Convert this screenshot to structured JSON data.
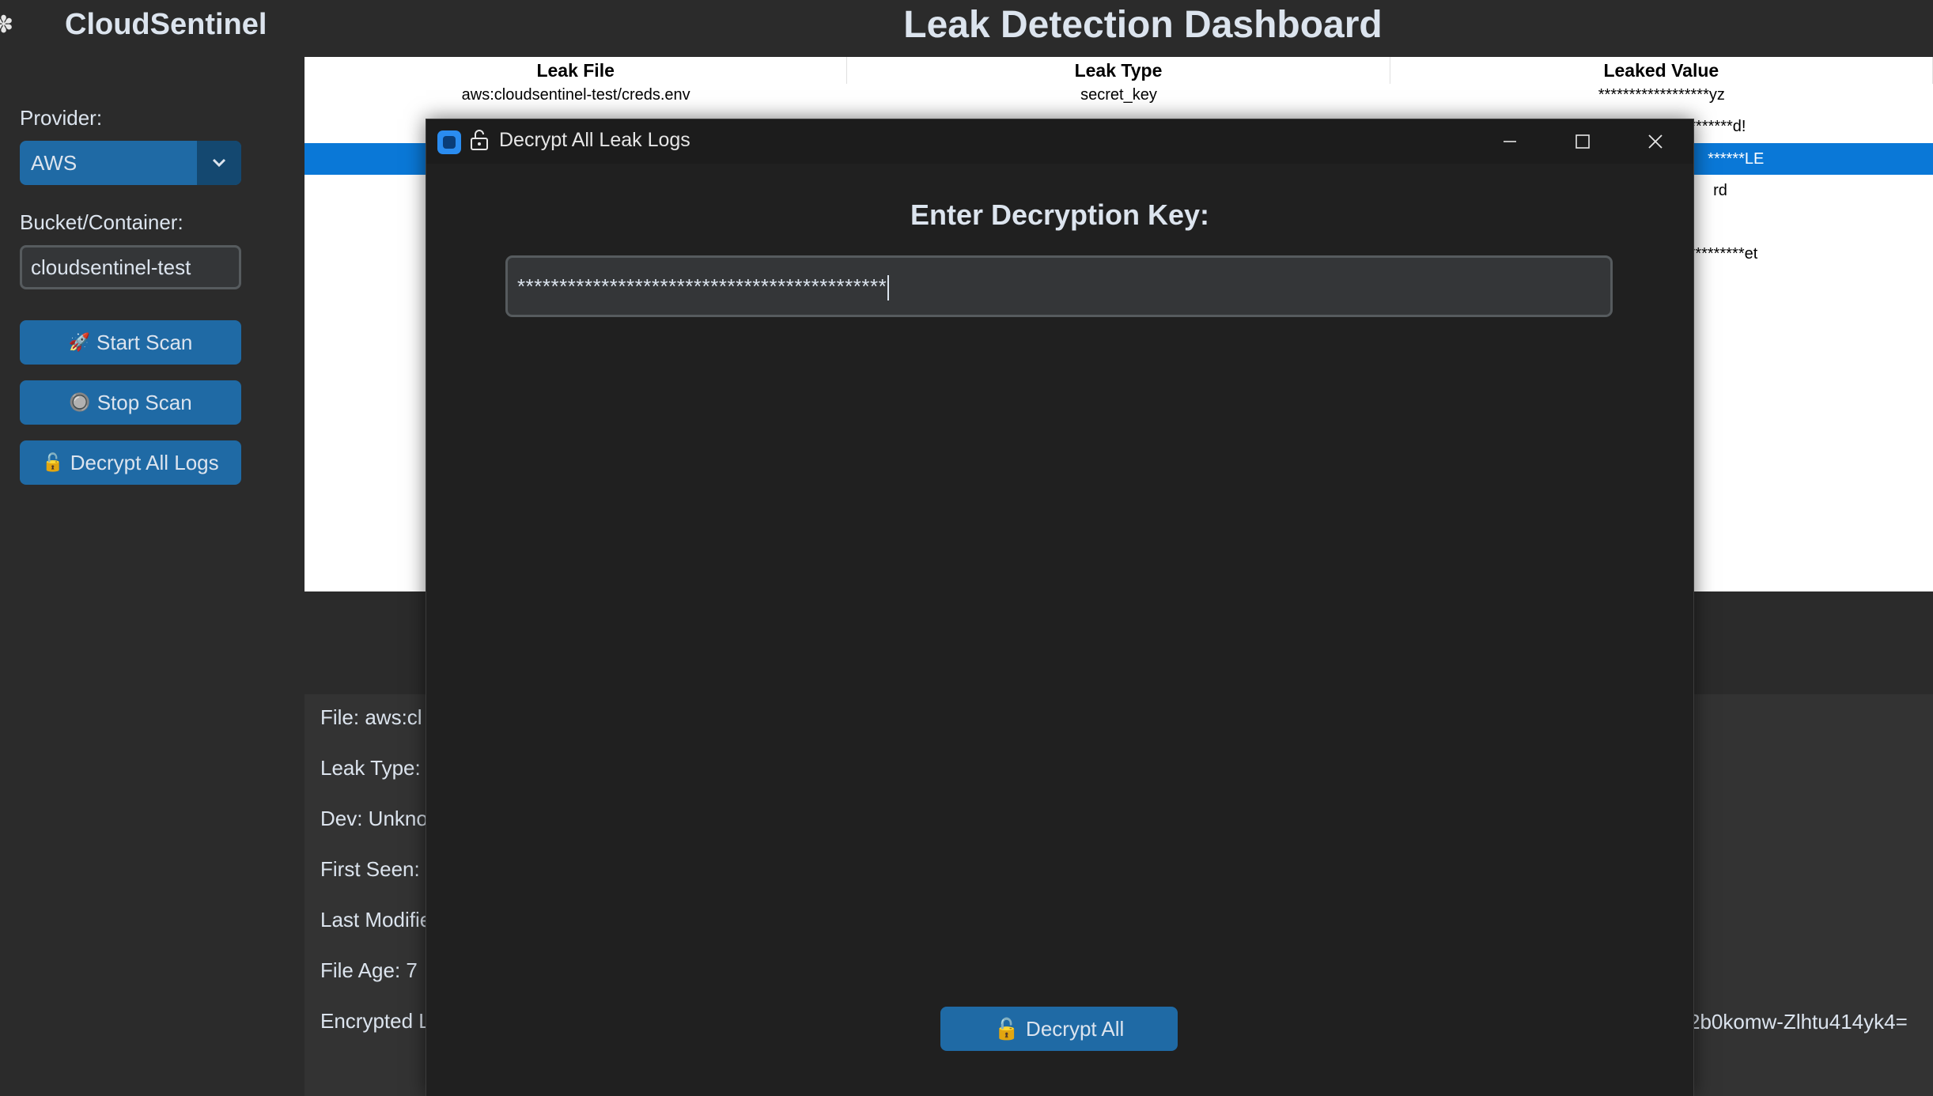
{
  "app": {
    "logo_icon": "gear-icon",
    "title": "CloudSentinel",
    "dashboard_title": "Leak Detection Dashboard"
  },
  "sidebar": {
    "provider_label": "Provider:",
    "provider_value": "AWS",
    "bucket_label": "Bucket/Container:",
    "bucket_value": "cloudsentinel-test",
    "start_scan": {
      "icon": "🚀",
      "label": "Start Scan"
    },
    "stop_scan": {
      "icon": "🔘",
      "label": "Stop Scan"
    },
    "decrypt_logs": {
      "icon": "🔓",
      "label": "Decrypt All Logs"
    }
  },
  "table": {
    "headers": [
      "Leak File",
      "Leak Type",
      "Leaked Value"
    ],
    "rows": [
      [
        "aws:cloudsentinel-test/creds.env",
        "secret_key",
        "******************yz"
      ],
      [
        "",
        "",
        "**********d!"
      ],
      [
        "",
        "",
        "******LE"
      ],
      [
        "",
        "",
        "rd"
      ],
      [
        "",
        "",
        ""
      ],
      [
        "",
        "",
        "**********et"
      ]
    ]
  },
  "details": {
    "file": "File: aws:cl",
    "leak_type": "Leak Type:",
    "dev": "Dev: Unkno",
    "first_seen": "First Seen:",
    "last_modified": "Last Modifie",
    "file_age": "File Age: 7",
    "encrypted": "Encrypted L",
    "encrypted_tail": "2b0komw-Zlhtu414yk4="
  },
  "dialog": {
    "title": "Decrypt All Leak Logs",
    "heading": "Enter Decryption Key:",
    "key_value": "********************************************",
    "button_icon": "🔓",
    "button_label": "Decrypt All",
    "minimize": "—",
    "maximize": "☐",
    "close": "✕"
  }
}
